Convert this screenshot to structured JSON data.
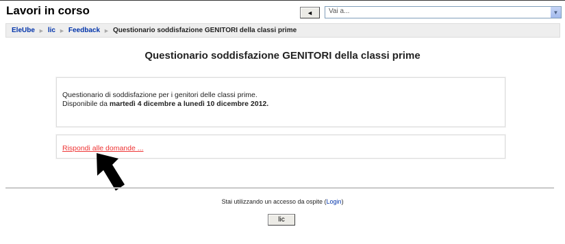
{
  "header": {
    "site_title": "Lavori in corso",
    "jump_back_icon": "left-triangle",
    "jump_to_value": "Vai a...",
    "jump_to_arrow_icon": "chevron-down"
  },
  "breadcrumb": {
    "items": [
      "EleUbe",
      "lic",
      "Feedback"
    ],
    "separator": "►",
    "current": "Questionario soddisfazione GENITORI della classi prime"
  },
  "main": {
    "title": "Questionario soddisfazione GENITORI della classi prime",
    "intro_line1": "Questionario di soddisfazione per i genitori delle classi prime.",
    "intro_line2_prefix": "Disponibile da",
    "intro_line2_dates": "martedì 4 dicembre a lunedì 10 dicembre 2012.",
    "answer_link": "Rispondi alle domande ..."
  },
  "annotation": {
    "arrow_icon": "black-arrow-up-icon"
  },
  "footer": {
    "login_text": "Stai utilizzando un accesso da ospite (",
    "login_link": "Login",
    "login_close": ")",
    "home_button": "lic"
  },
  "colors": {
    "link": "#0033aa",
    "answer_link": "#ee3333",
    "navbar_bg": "#eeeeee"
  }
}
